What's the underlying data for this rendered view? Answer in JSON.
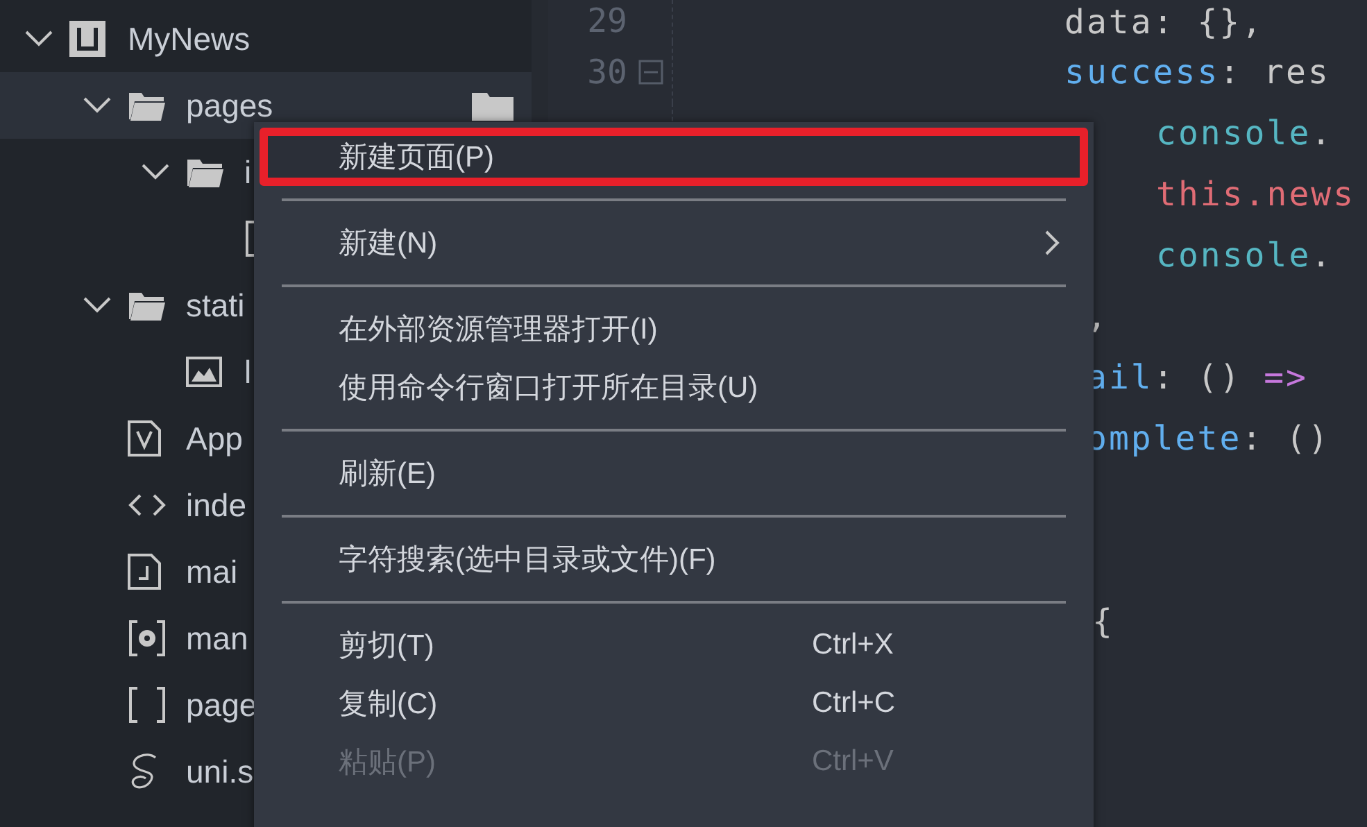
{
  "explorer": {
    "tree": [
      {
        "label": "MyNews",
        "kind": "project",
        "expanded": true,
        "selected": false,
        "children": [
          {
            "label": "pages",
            "kind": "folder",
            "expanded": true,
            "selected": true,
            "children": [
              {
                "label": "i",
                "kind": "folder",
                "expanded": true,
                "selected": false,
                "children": [
                  {
                    "kind": "bracket",
                    "selected": false
                  }
                ]
              }
            ]
          },
          {
            "label": "stati",
            "kind": "folder",
            "expanded": true,
            "selected": false,
            "children": [
              {
                "label": "l",
                "kind": "image",
                "selected": false
              }
            ]
          },
          {
            "label": "App",
            "kind": "vue",
            "selected": false
          },
          {
            "label": "inde",
            "kind": "html",
            "selected": false
          },
          {
            "label": "mai",
            "kind": "js",
            "selected": false
          },
          {
            "label": "man",
            "kind": "config",
            "selected": false
          },
          {
            "label": "page",
            "kind": "brackets",
            "selected": false
          },
          {
            "label": "uni.s",
            "kind": "sass",
            "selected": false
          }
        ]
      }
    ]
  },
  "editor": {
    "lines": [
      {
        "number": "29",
        "tokens": [
          {
            "text": "data: {},",
            "kind": "plain"
          }
        ]
      },
      {
        "number": "30",
        "fold": true,
        "tokens": [
          {
            "text": "success",
            "kind": "key"
          },
          {
            "text": ": res",
            "kind": "plain"
          }
        ]
      },
      {
        "tokens": [
          {
            "text": "console",
            "kind": "call"
          },
          {
            "text": ".",
            "kind": "plain"
          }
        ]
      },
      {
        "tokens": [
          {
            "text": "this.news",
            "kind": "this"
          }
        ]
      },
      {
        "tokens": [
          {
            "text": "console",
            "kind": "call"
          },
          {
            "text": ".",
            "kind": "plain"
          }
        ]
      },
      {
        "tokens": [
          {
            "text": ",",
            "kind": "plain"
          }
        ]
      },
      {
        "tokens": [
          {
            "text": "ail",
            "kind": "key"
          },
          {
            "text": ": () ",
            "kind": "plain"
          },
          {
            "text": "=>",
            "kind": "op"
          }
        ]
      },
      {
        "tokens": [
          {
            "text": "omplete",
            "kind": "key"
          },
          {
            "text": ": ()",
            "kind": "plain"
          }
        ]
      },
      {
        "tokens": [
          {
            "text": "{",
            "kind": "plain"
          }
        ]
      }
    ]
  },
  "context_menu": {
    "items": [
      {
        "kind": "item",
        "label": "新建页面(P)",
        "highlighted": true,
        "disabled": false
      },
      {
        "kind": "separator"
      },
      {
        "kind": "item",
        "label": "新建(N)",
        "submenu": true,
        "disabled": false
      },
      {
        "kind": "separator"
      },
      {
        "kind": "item",
        "label": "在外部资源管理器打开(I)",
        "disabled": false
      },
      {
        "kind": "item",
        "label": "使用命令行窗口打开所在目录(U)",
        "disabled": false
      },
      {
        "kind": "separator"
      },
      {
        "kind": "item",
        "label": "刷新(E)",
        "disabled": false
      },
      {
        "kind": "separator"
      },
      {
        "kind": "item",
        "label": "字符搜索(选中目录或文件)(F)",
        "disabled": false
      },
      {
        "kind": "separator"
      },
      {
        "kind": "item",
        "label": "剪切(T)",
        "shortcut": "Ctrl+X",
        "disabled": false
      },
      {
        "kind": "item",
        "label": "复制(C)",
        "shortcut": "Ctrl+C",
        "disabled": false
      },
      {
        "kind": "item",
        "label": "粘贴(P)",
        "shortcut": "Ctrl+V",
        "disabled": true
      }
    ]
  }
}
